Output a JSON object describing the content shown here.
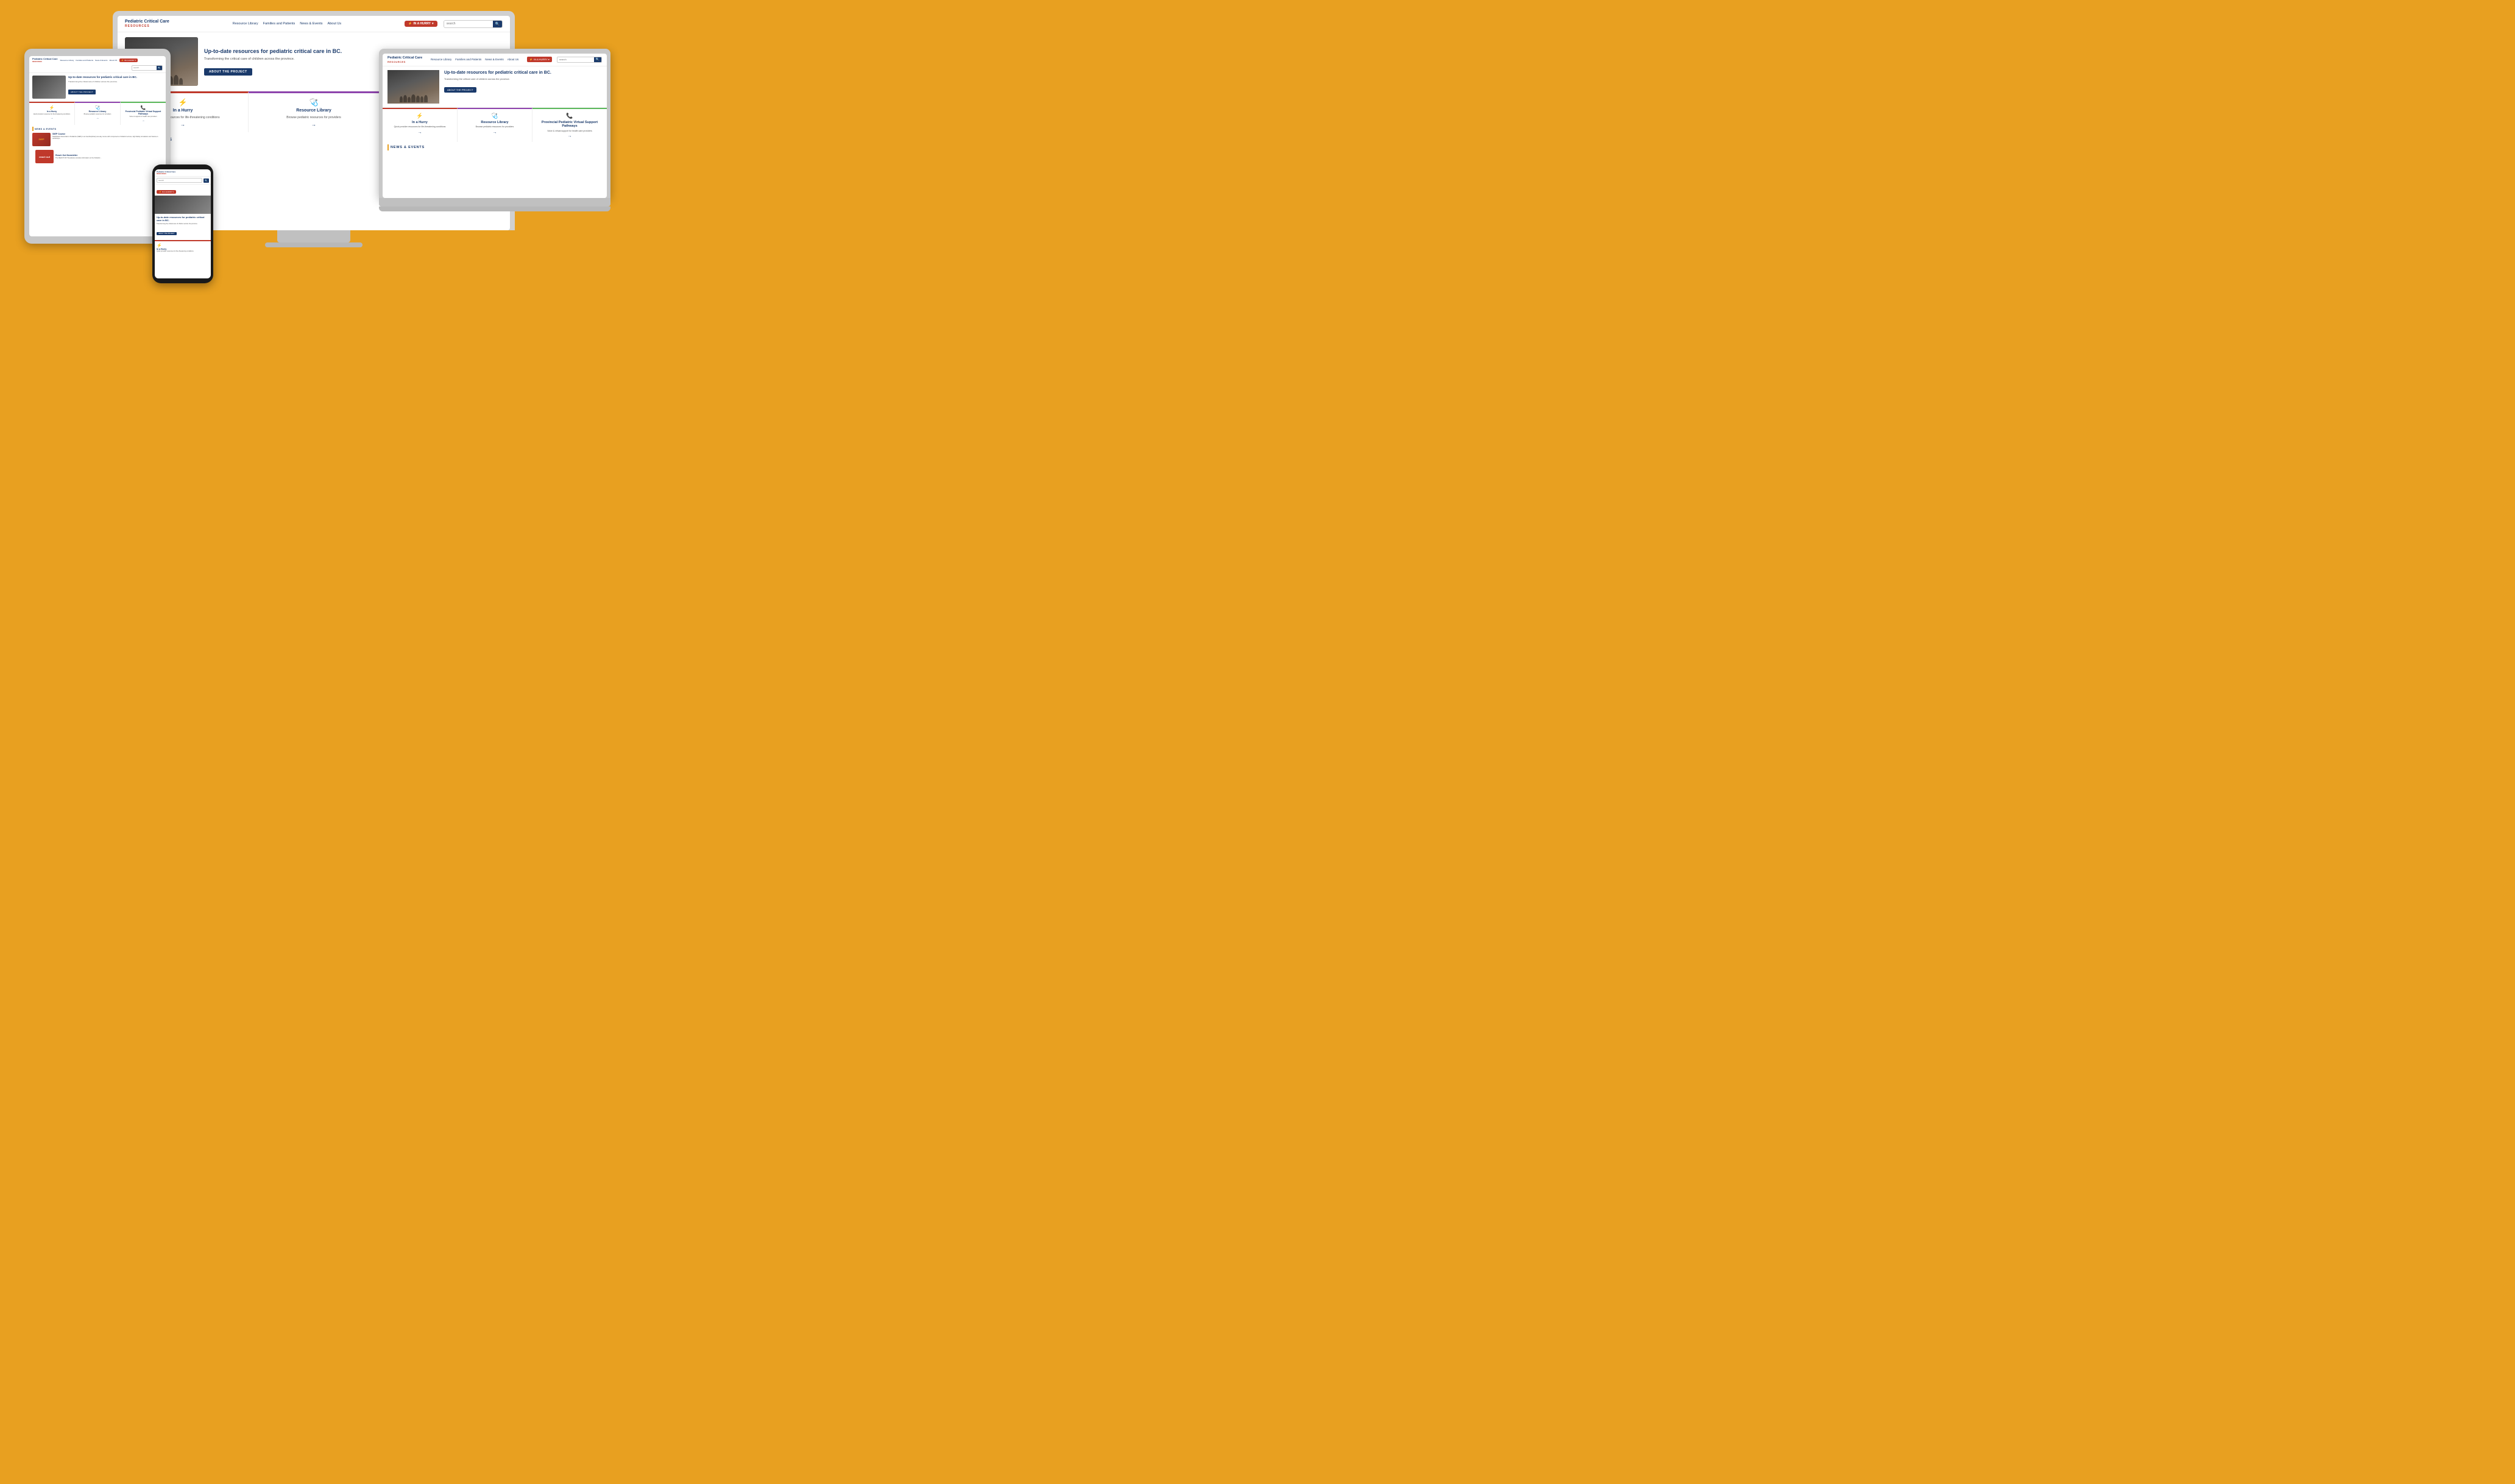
{
  "site": {
    "logo": "Pediatric Critical Care",
    "logo_sub": "RESOURCES",
    "nav": [
      "Resource Library",
      "Families and Patients",
      "News & Events",
      "About Us"
    ],
    "hurry_btn": "IN A HURRY",
    "search_placeholder": "search",
    "search_btn": "🔍",
    "hero": {
      "title": "Up-to-date resources for pediatric critical care in BC.",
      "subtitle": "Transforming the critical care of children across the province.",
      "about_btn": "ABOUT THE PROJECT"
    },
    "cards": [
      {
        "title": "In a Hurry",
        "desc": "Quick provider resources for life-threatening conditions",
        "icon": "⚡",
        "accent": "red"
      },
      {
        "title": "Resource Library",
        "desc": "Browse pediatric resources for providers",
        "icon": "🩺",
        "accent": "purple"
      },
      {
        "title": "Provincial Pediatric Virtual Support Pathways",
        "desc": "Voice & virtual support for health care providers",
        "icon": "📞",
        "accent": "green"
      }
    ],
    "news_heading": "NEWS & EVENTS",
    "news_items": [
      {
        "tag": "StEP",
        "title": "StEP Course",
        "desc": "Stabilization Essentials in Pediatrics (StEP) is an interdisciplinary two-day course with components of didactic lectures, high fidelity simulations and hands-on workshops, delivered by Pediatric's Intensive Care Unit (PICU) faculty. This course has been created as part of this project work."
      },
      {
        "tag": "reach out",
        "title": "Reach Out Newsletter",
        "desc": "The REACH OUT Newsletter provides information on the Pediatric..."
      }
    ],
    "about_section_label": "ABOUT THE PROJECT"
  },
  "devices": {
    "desktop_position": "center-back",
    "tablet_position": "left",
    "phone_position": "center-bottom",
    "laptop_position": "right"
  }
}
